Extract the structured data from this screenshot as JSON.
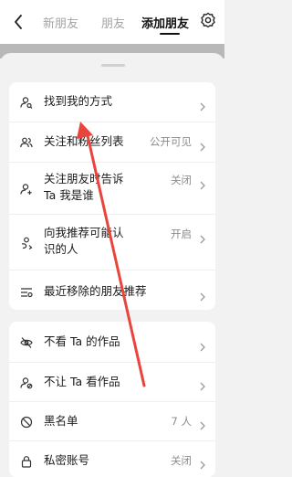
{
  "header": {
    "tabs": [
      {
        "label": "新朋友",
        "active": false
      },
      {
        "label": "朋友",
        "active": false
      },
      {
        "label": "添加朋友",
        "active": true
      }
    ]
  },
  "privacy_card": {
    "rows": [
      {
        "label": "找到我的方式",
        "value": ""
      },
      {
        "label": "关注和粉丝列表",
        "value": "公开可见"
      },
      {
        "label_line1": "关注朋友时告诉",
        "label_line2": "Ta 我是谁",
        "value": "关闭"
      },
      {
        "label_line1": "向我推荐可能认",
        "label_line2": "识的人",
        "value": "开启"
      },
      {
        "label": "最近移除的朋友推荐",
        "value": ""
      }
    ]
  },
  "block_card": {
    "rows": [
      {
        "label": "不看 Ta 的作品",
        "value": ""
      },
      {
        "label": "不让 Ta 看作品",
        "value": ""
      },
      {
        "label": "黑名单",
        "value": "7 人"
      },
      {
        "label": "私密账号",
        "value": "关闭"
      }
    ]
  },
  "colors": {
    "annotation_arrow": "#e8453c",
    "background": "#f2f2f3",
    "card": "#ffffff"
  }
}
